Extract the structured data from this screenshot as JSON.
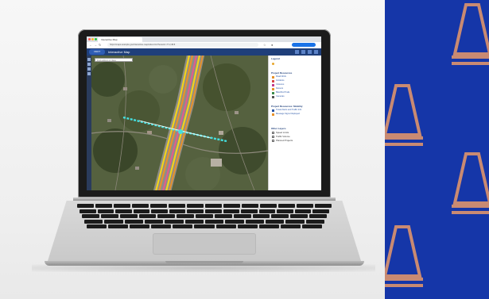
{
  "browser": {
    "tab_title": "Interactive Map",
    "address": "https://maps.example.gov/interactive-map/index.html?extent=-77.2,38.8"
  },
  "app": {
    "logo_text": "VDOT",
    "title": "Interactive Map",
    "search_placeholder": "Find address or place"
  },
  "side_panel": {
    "title": "Legend",
    "sections": [
      {
        "heading": "Project Resources",
        "items": [
          "Road Work",
          "Incidents",
          "Closures",
          "Detours",
          "Bike/Ped Trails",
          "Cameras"
        ]
      },
      {
        "heading": "Project Resources: Mobility",
        "items": [
          "Travel Alerts and Traffic Info",
          "Message Signs Displayed"
        ]
      },
      {
        "heading": "Other Layers",
        "items": [
          "Speed Limits",
          "Traffic Volume",
          "Planned Projects"
        ]
      }
    ]
  },
  "colors": {
    "brand_blue": "#1536a8",
    "cone_stripe": "#c98a72",
    "header": "#1f3f7a",
    "highway_yellow": "#f2d21b",
    "highway_orange": "#e7922b",
    "highway_pink": "#e35a8e",
    "highway_cyan": "#44e0e0"
  },
  "icons": {
    "cone": "traffic-cone-icon",
    "search": "search-icon",
    "menu": "menu-icon"
  }
}
